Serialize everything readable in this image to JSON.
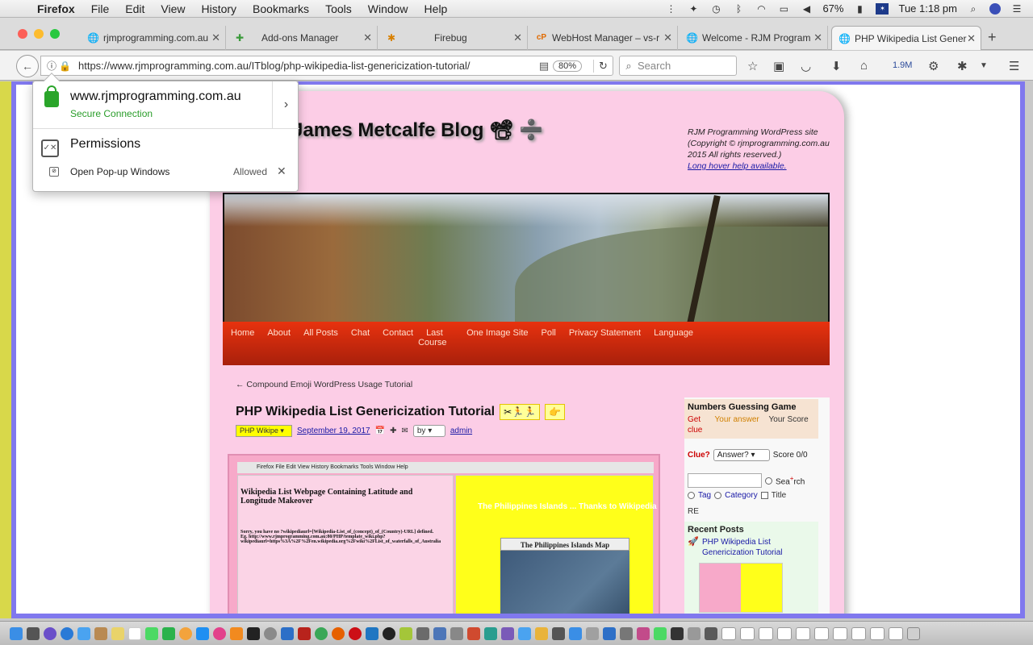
{
  "menubar": {
    "app": "Firefox",
    "items": [
      "File",
      "Edit",
      "View",
      "History",
      "Bookmarks",
      "Tools",
      "Window",
      "Help"
    ],
    "battery": "67%",
    "clock": "Tue 1:18 pm"
  },
  "tabs": [
    {
      "label": "rjmprogramming.com.au",
      "icon": "globe-icon"
    },
    {
      "label": "Add-ons Manager",
      "icon": "puzzle-icon"
    },
    {
      "label": "Firebug",
      "icon": "bug-icon"
    },
    {
      "label": "WebHost Manager – vs-r",
      "icon": "cpanel-icon"
    },
    {
      "label": "Welcome - RJM Program",
      "icon": "globe-icon"
    },
    {
      "label": "PHP Wikipedia List Gener",
      "icon": "globe-icon"
    }
  ],
  "navbar": {
    "url": "https://www.rjmprogramming.com.au/ITblog/php-wikipedia-list-genericization-tutorial/",
    "zoom": "80%",
    "search_placeholder": "Search",
    "download_count": "1.9M"
  },
  "popup": {
    "host": "www.rjmprogramming.com.au",
    "secure": "Secure Connection",
    "permissions_title": "Permissions",
    "permission_label": "Open Pop-up Windows",
    "permission_state": "Allowed"
  },
  "site": {
    "title": "Robert James Metcalfe Blog",
    "title_emoji": "📽 ➗",
    "note": "RJM Programming WordPress site (Copyright © rjmprogramming.com.au 2015 All rights reserved.)",
    "note_link": "Long hover help available.",
    "nav": [
      "Home",
      "About",
      "All Posts",
      "Chat",
      "Contact",
      "Last",
      "One Image Site",
      "Poll",
      "Privacy Statement",
      "Language"
    ],
    "nav_second_line": "Course",
    "prev_link": "← Compound Emoji WordPress Usage Tutorial"
  },
  "post": {
    "title": "PHP Wikipedia List Genericization Tutorial",
    "badge1": "✂🏃🏃",
    "badge2": "👉",
    "select_value": "PHP Wikipe",
    "date": "September 19, 2017",
    "by_label": "by",
    "author": "admin",
    "image_heading": "Wikipedia List Webpage Containing Latitude and Longitude Makeover",
    "image_paragraph": "Sorry, you have no ?wikipediaurl=[Wikipedia-List_of_(concept)_of_(Country)-URL] defined. Eg. http://www.rjmprogramming.com.au:80/PHP/template_wiki.php?wikipediaurl=https%3A%2F%2Fen.wikipedia.org%2Fwiki%2FList_of_waterfalls_of_Australia",
    "image_right_link": "The Philippines Islands ... Thanks to Wikipedia",
    "image_map_title": "The Philippines Islands Map",
    "image_browser_bar": "Firefox File Edit View History Bookmarks Tools Window Help"
  },
  "sidebar": {
    "game_title": "Numbers Guessing Game",
    "col1": "Get clue",
    "col2": "Your answer",
    "col3": "Your Score",
    "clue_label": "Clue?",
    "answer_select": "Answer?",
    "score": "Score 0/0",
    "search_label": "Sea",
    "search_sup": "+",
    "search_label_end": "rch",
    "tag_label": "Tag",
    "category_label": "Category",
    "title_label": "Title",
    "re_label": "RE",
    "recent_title": "Recent Posts",
    "recent_item": "PHP Wikipedia List Genericization Tutorial"
  }
}
